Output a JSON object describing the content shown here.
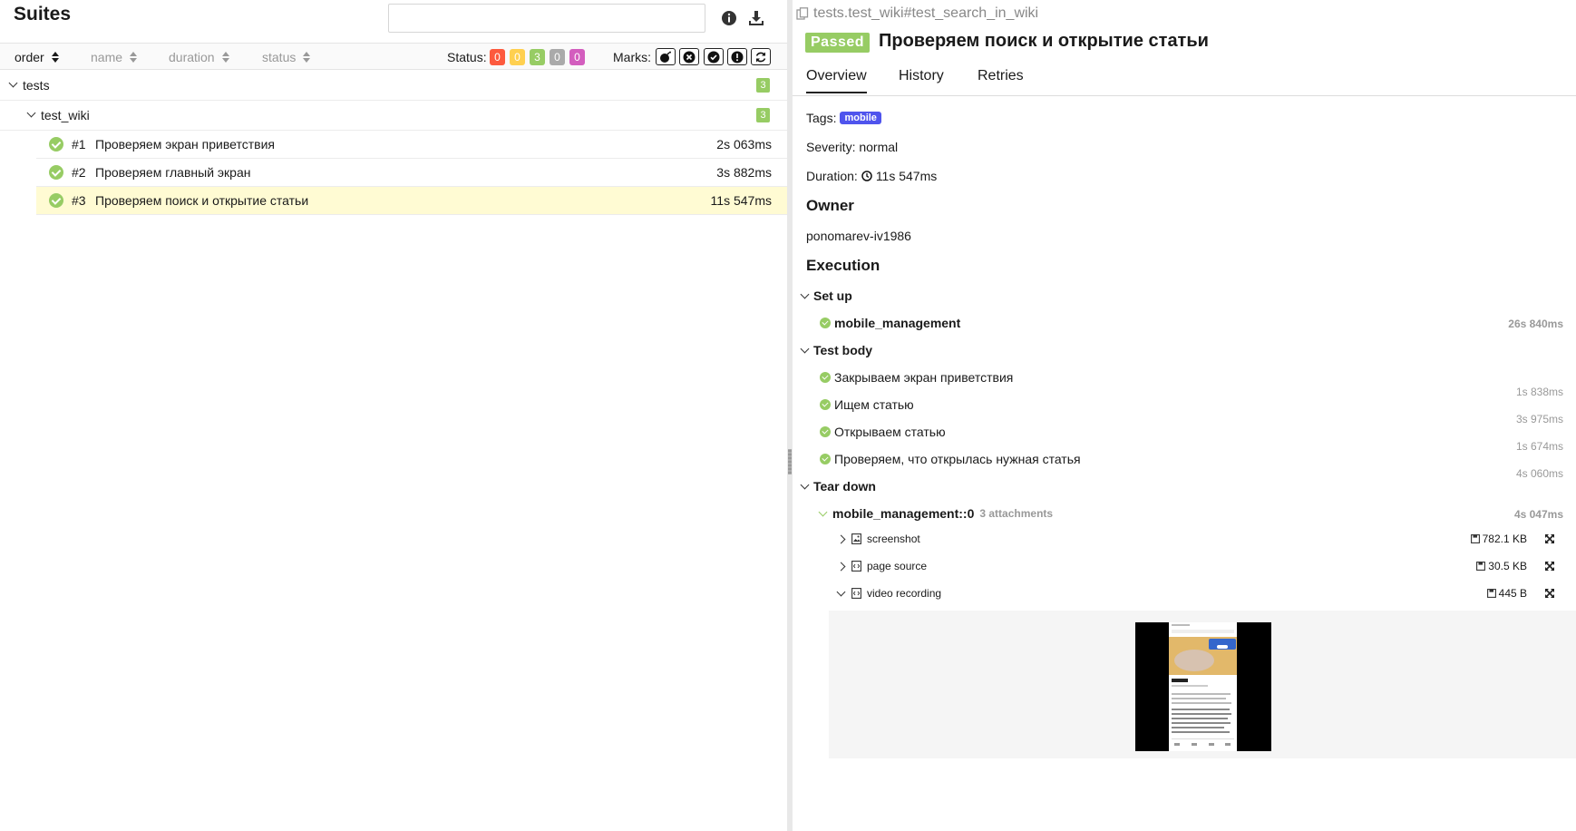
{
  "left": {
    "title": "Suites",
    "sort": {
      "order": "order",
      "name": "name",
      "duration": "duration",
      "status": "status"
    },
    "status_label": "Status:",
    "status_counts": [
      {
        "value": "0",
        "color": "#fd5a3e"
      },
      {
        "value": "0",
        "color": "#ffd050"
      },
      {
        "value": "3",
        "color": "#97cc64"
      },
      {
        "value": "0",
        "color": "#aaaaaa"
      },
      {
        "value": "0",
        "color": "#d35ebe"
      }
    ],
    "marks_label": "Marks:",
    "marks": [
      "bomb-icon",
      "close-circle-icon",
      "check-circle-icon",
      "exclamation-circle-icon",
      "refresh-icon"
    ],
    "tree": {
      "root_label": "tests",
      "root_count": "3",
      "suite_label": "test_wiki",
      "suite_count": "3",
      "tests": [
        {
          "num": "#1",
          "name": "Проверяем экран приветствия",
          "duration": "2s 063ms"
        },
        {
          "num": "#2",
          "name": "Проверяем главный экран",
          "duration": "3s 882ms"
        },
        {
          "num": "#3",
          "name": "Проверяем поиск и открытие статьи",
          "duration": "11s 547ms"
        }
      ]
    }
  },
  "right": {
    "fullname": "tests.test_wiki#test_search_in_wiki",
    "status": "Passed",
    "title": "Проверяем поиск и открытие статьи",
    "tabs": [
      "Overview",
      "History",
      "Retries"
    ],
    "tags_label": "Tags:",
    "tag": "mobile",
    "severity": "Severity: normal",
    "duration_label": "Duration:",
    "duration": "11s 547ms",
    "owner_heading": "Owner",
    "owner": "ponomarev-iv1986",
    "execution_heading": "Execution",
    "setup": {
      "label": "Set up",
      "steps": [
        {
          "name": "mobile_management",
          "duration": "26s 840ms"
        }
      ]
    },
    "body": {
      "label": "Test body",
      "steps": [
        {
          "name": "Закрываем экран приветствия",
          "duration": "1s 838ms"
        },
        {
          "name": "Ищем статью",
          "duration": "3s 975ms"
        },
        {
          "name": "Открываем статью",
          "duration": "1s 674ms"
        },
        {
          "name": "Проверяем, что открылась нужная статья",
          "duration": "4s 060ms"
        }
      ]
    },
    "teardown": {
      "label": "Tear down",
      "step": "mobile_management::0",
      "attachments_count": "3 attachments",
      "duration": "4s 047ms",
      "attachments": [
        {
          "name": "screenshot",
          "size": "782.1 KB",
          "icon": "image-file-icon",
          "expanded": false
        },
        {
          "name": "page source",
          "size": "30.5 KB",
          "icon": "code-file-icon",
          "expanded": false
        },
        {
          "name": "video recording",
          "size": "445 B",
          "icon": "code-file-icon",
          "expanded": true
        }
      ]
    }
  }
}
